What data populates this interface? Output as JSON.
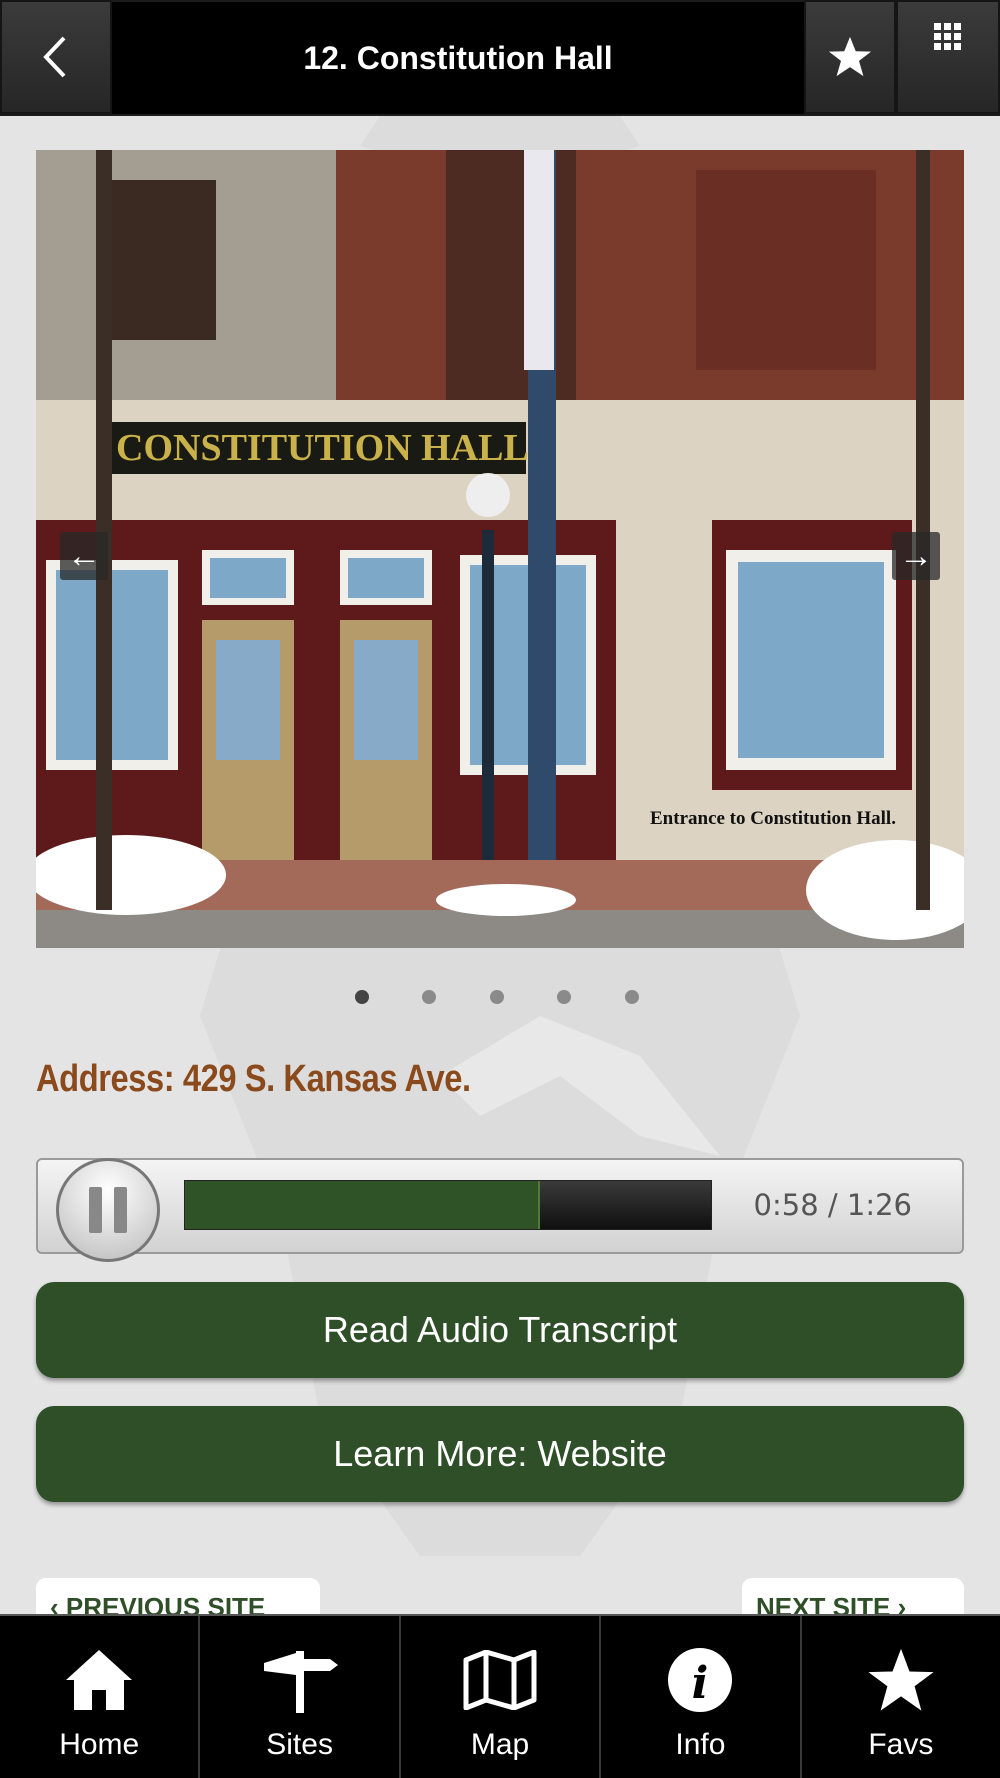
{
  "header": {
    "title": "12. Constitution Hall",
    "back_icon": "chevron-left-icon",
    "favorite_icon": "star-icon",
    "menu_icon": "grid-icon"
  },
  "slider": {
    "caption": "Entrance to Constitution Hall.",
    "sign_text": "CONSTITUTION HALL",
    "slide_count": 5,
    "active_slide": 1
  },
  "address": "Address: 429 S. Kansas Ave.",
  "audio": {
    "time": "0:58 / 1:26",
    "progress": 0.674,
    "state": "playing"
  },
  "buttons": {
    "transcript": "Read Audio Transcript",
    "website": "Learn More: Website"
  },
  "site_nav": {
    "previous": "PREVIOUS SITE",
    "next": "NEXT SITE"
  },
  "tabs": [
    {
      "label": "Home",
      "icon": "home-icon"
    },
    {
      "label": "Sites",
      "icon": "signpost-icon"
    },
    {
      "label": "Map",
      "icon": "map-icon"
    },
    {
      "label": "Info",
      "icon": "info-icon"
    },
    {
      "label": "Favs",
      "icon": "star-icon"
    }
  ],
  "colors": {
    "accent_green": "#2f4f28",
    "address_brown": "#8b4a1c",
    "header_black": "#000000"
  }
}
